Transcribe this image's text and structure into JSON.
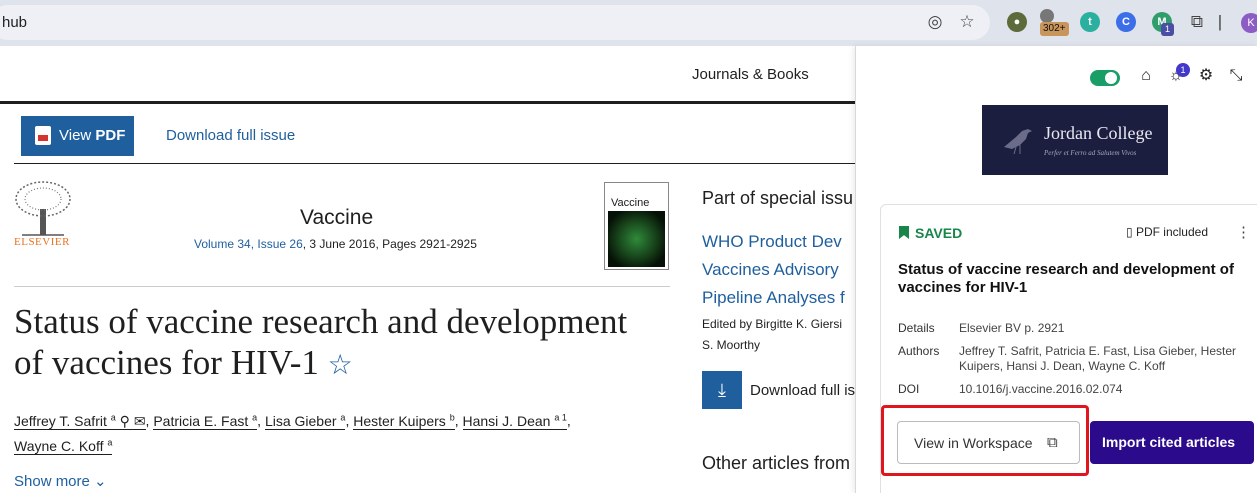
{
  "browser": {
    "url_fragment": "hub",
    "ext_badge": "302+",
    "ext_count": "1",
    "profile_initial": "K"
  },
  "article_page": {
    "nav_link": "Journals & Books",
    "view_pdf_prefix": "View ",
    "view_pdf_bold": "PDF",
    "download_issue": "Download full issue",
    "publisher": "ELSEVIER",
    "journal_name": "Vaccine",
    "volume_link": "Volume 34, Issue 26",
    "issue_meta": ", 3 June 2016, Pages 2921-2925",
    "cover_title": "Vaccine",
    "title_line1": "Status of vaccine research and development",
    "title_line2": "of vaccines for HIV-1",
    "authors": [
      {
        "name": "Jeffrey T. Safrit",
        "sup": "a"
      },
      {
        "name": "Patricia E. Fast",
        "sup": "a"
      },
      {
        "name": "Lisa Gieber",
        "sup": "a"
      },
      {
        "name": "Hester Kuipers",
        "sup": "b"
      },
      {
        "name": "Hansi J. Dean",
        "sup": "a 1"
      },
      {
        "name": "Wayne C. Koff",
        "sup": "a"
      }
    ],
    "show_more": "Show more",
    "special_issue_heading": "Part of special issu",
    "special_links": [
      "WHO Product Dev",
      "Vaccines Advisory",
      "Pipeline Analyses f"
    ],
    "edited_by_line1": "Edited by Birgitte K. Giersi",
    "edited_by_line2": "S. Moorthy",
    "download_full": "Download full is",
    "other_articles": "Other articles from"
  },
  "panel": {
    "notification_count": "1",
    "institution": {
      "name": "Jordan College",
      "motto": "Perfer et Ferro ad Salutem Vivos"
    },
    "saved_label": "SAVED",
    "pdf_included": "PDF included",
    "kebab": "⋮",
    "card_title": "Status of vaccine research and development of vaccines for HIV-1",
    "details_label": "Details",
    "details_value": "Elsevier BV p. 2921",
    "authors_label": "Authors",
    "authors_value": "Jeffrey T. Safrit, Patricia E. Fast, Lisa Gieber, Hester Kuipers, Hansi J. Dean, Wayne C. Koff",
    "doi_label": "DOI",
    "doi_value": "10.1016/j.vaccine.2016.02.074",
    "view_workspace": "View in Workspace",
    "import_cited": "Import cited articles"
  },
  "colors": {
    "accent": "#1f5f9e",
    "saved": "#18864b",
    "import": "#2b0a8c",
    "highlight": "#e0151d"
  }
}
